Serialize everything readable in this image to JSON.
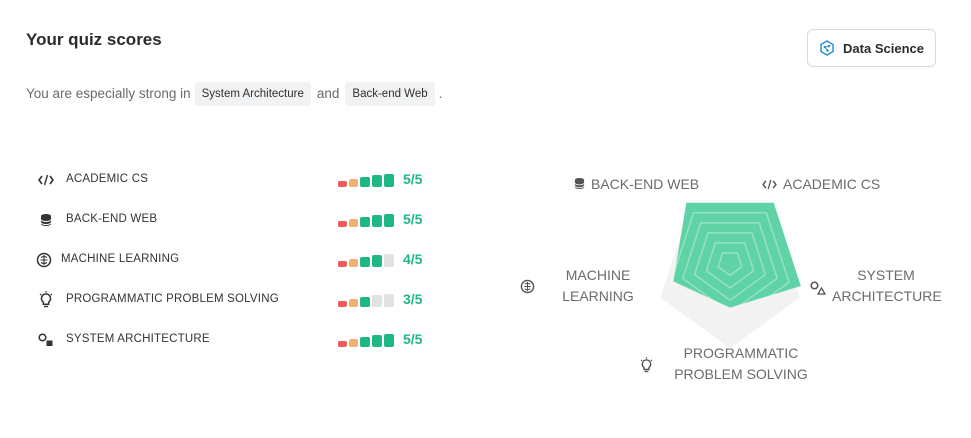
{
  "header": {
    "title": "Your quiz scores",
    "category_button": "Data Science"
  },
  "summary": {
    "prefix": "You are especially strong in",
    "strength_1": "System Architecture",
    "conjunction": "and",
    "strength_2": "Back-end Web",
    "suffix": "."
  },
  "colors": {
    "red": "#ef5b5b",
    "orange": "#f0b06e",
    "green": "#1fb784",
    "empty": "#e2e2e2",
    "radar_fill": "#5fd3a6"
  },
  "scores": [
    {
      "label": "ACADEMIC CS",
      "value": "5/5",
      "score": 5,
      "icon": "code-icon"
    },
    {
      "label": "BACK-END WEB",
      "value": "5/5",
      "score": 5,
      "icon": "database-icon"
    },
    {
      "label": "MACHINE LEARNING",
      "value": "4/5",
      "score": 4,
      "icon": "brain-icon"
    },
    {
      "label": "PROGRAMMATIC PROBLEM SOLVING",
      "value": "3/5",
      "score": 3,
      "icon": "lightbulb-icon"
    },
    {
      "label": "SYSTEM ARCHITECTURE",
      "value": "5/5",
      "score": 5,
      "icon": "shapes-icon"
    }
  ],
  "radar": {
    "labels": {
      "back_end_web": "BACK-END WEB",
      "academic_cs": "ACADEMIC CS",
      "machine_learning_1": "MACHINE",
      "machine_learning_2": "LEARNING",
      "system_architecture_1": "SYSTEM",
      "system_architecture_2": "ARCHITECTURE",
      "problem_solving_1": "PROGRAMMATIC",
      "problem_solving_2": "PROBLEM SOLVING"
    }
  }
}
